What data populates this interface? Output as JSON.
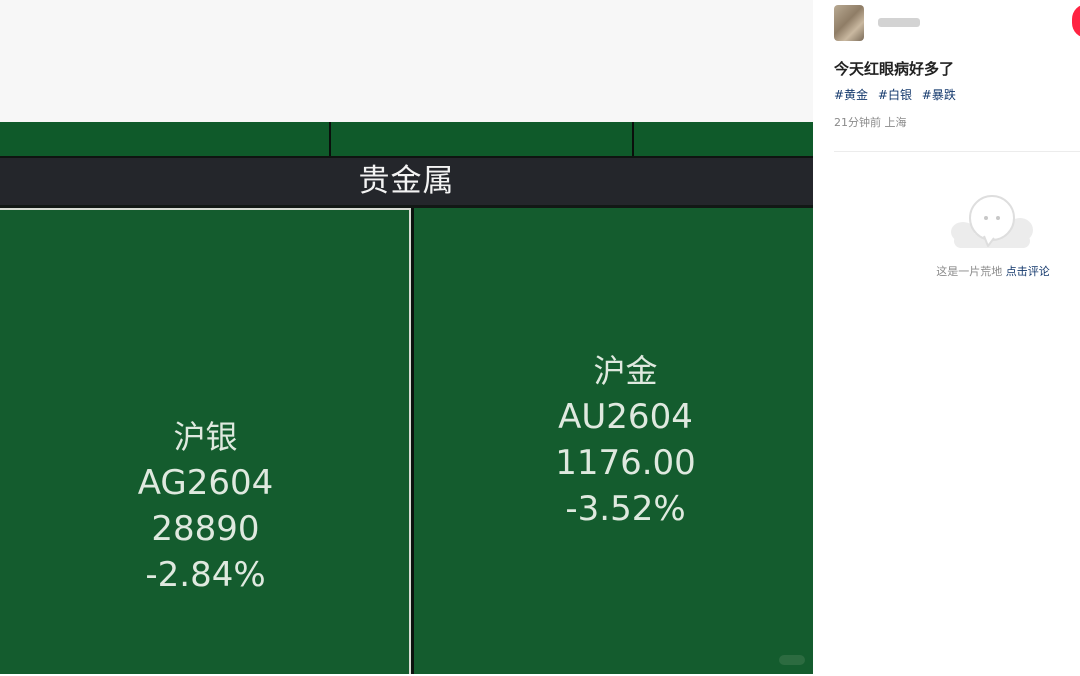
{
  "screen": {
    "sector_title": "贵金属",
    "tiles": [
      {
        "name": "沪银",
        "code": "AG2604",
        "price": "28890",
        "change": "-2.84%"
      },
      {
        "name": "沪金",
        "code": "AU2604",
        "price": "1176.00",
        "change": "-3.52%"
      }
    ]
  },
  "post": {
    "title": "今天红眼病好多了",
    "tags": [
      "#黄金",
      "#白银",
      "#暴跌"
    ],
    "meta": "21分钟前 上海"
  },
  "comments": {
    "empty_text": "这是一片荒地",
    "cta": "点击评论"
  },
  "colors": {
    "tile_green": "#145c2e",
    "header_dark": "#24262b",
    "tag_blue": "#13386c",
    "accent_red": "#ff2442"
  },
  "icons": {
    "avatar": "user-avatar",
    "empty": "chat-bubble-icon"
  }
}
